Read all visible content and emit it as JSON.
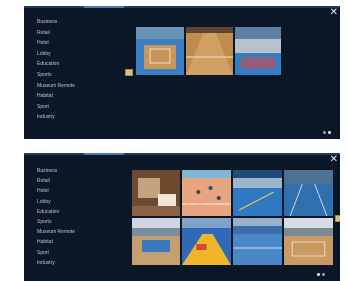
{
  "screens": [
    {
      "close_glyph": "✕",
      "menu": [
        "Business",
        "Retail",
        "Hotel",
        "Lobby",
        "Education",
        "Sports",
        "Museum Remote",
        "Habitat",
        "Sport",
        "Industry"
      ],
      "thumbnails": [
        "wood gym court",
        "parquet court",
        "blue sports hall"
      ]
    },
    {
      "close_glyph": "✕",
      "menu": [
        "Business",
        "Retail",
        "Hotel",
        "Lobby",
        "Education",
        "Sports",
        "Museum Remote",
        "Habitat",
        "Sport",
        "Industry"
      ],
      "thumbnails": [
        "wood office interior",
        "orange court",
        "blue sports hall",
        "blue court lanes",
        "gym interior",
        "colorful floor",
        "blue court",
        "wood sports hall"
      ]
    }
  ],
  "colors": {
    "panel_bg": "#0b1726",
    "menu_text": "#b9c6d6",
    "accent": "#d8c089"
  }
}
